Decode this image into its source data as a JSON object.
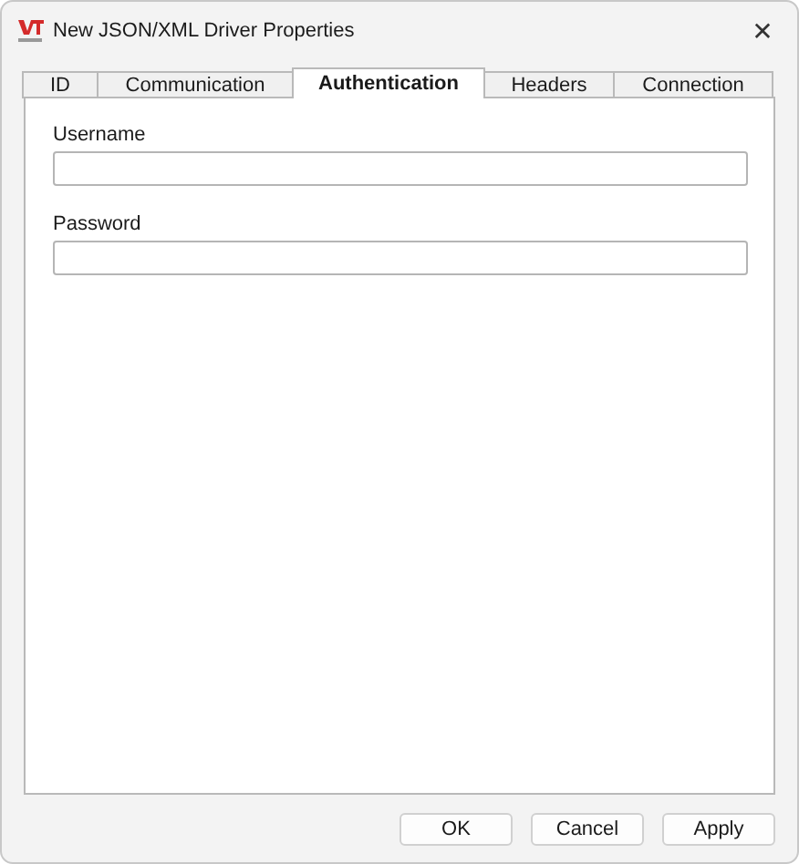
{
  "window": {
    "title": "New JSON/XML Driver Properties",
    "close": "✕"
  },
  "tabs": [
    {
      "label": "ID",
      "selected": false
    },
    {
      "label": "Communication",
      "selected": false
    },
    {
      "label": "Authentication",
      "selected": true
    },
    {
      "label": "Headers",
      "selected": false
    },
    {
      "label": "Connection",
      "selected": false
    }
  ],
  "fields": [
    {
      "label": "Username"
    },
    {
      "label": "Password"
    }
  ],
  "buttons": [
    "OK",
    "Cancel",
    "Apply"
  ]
}
